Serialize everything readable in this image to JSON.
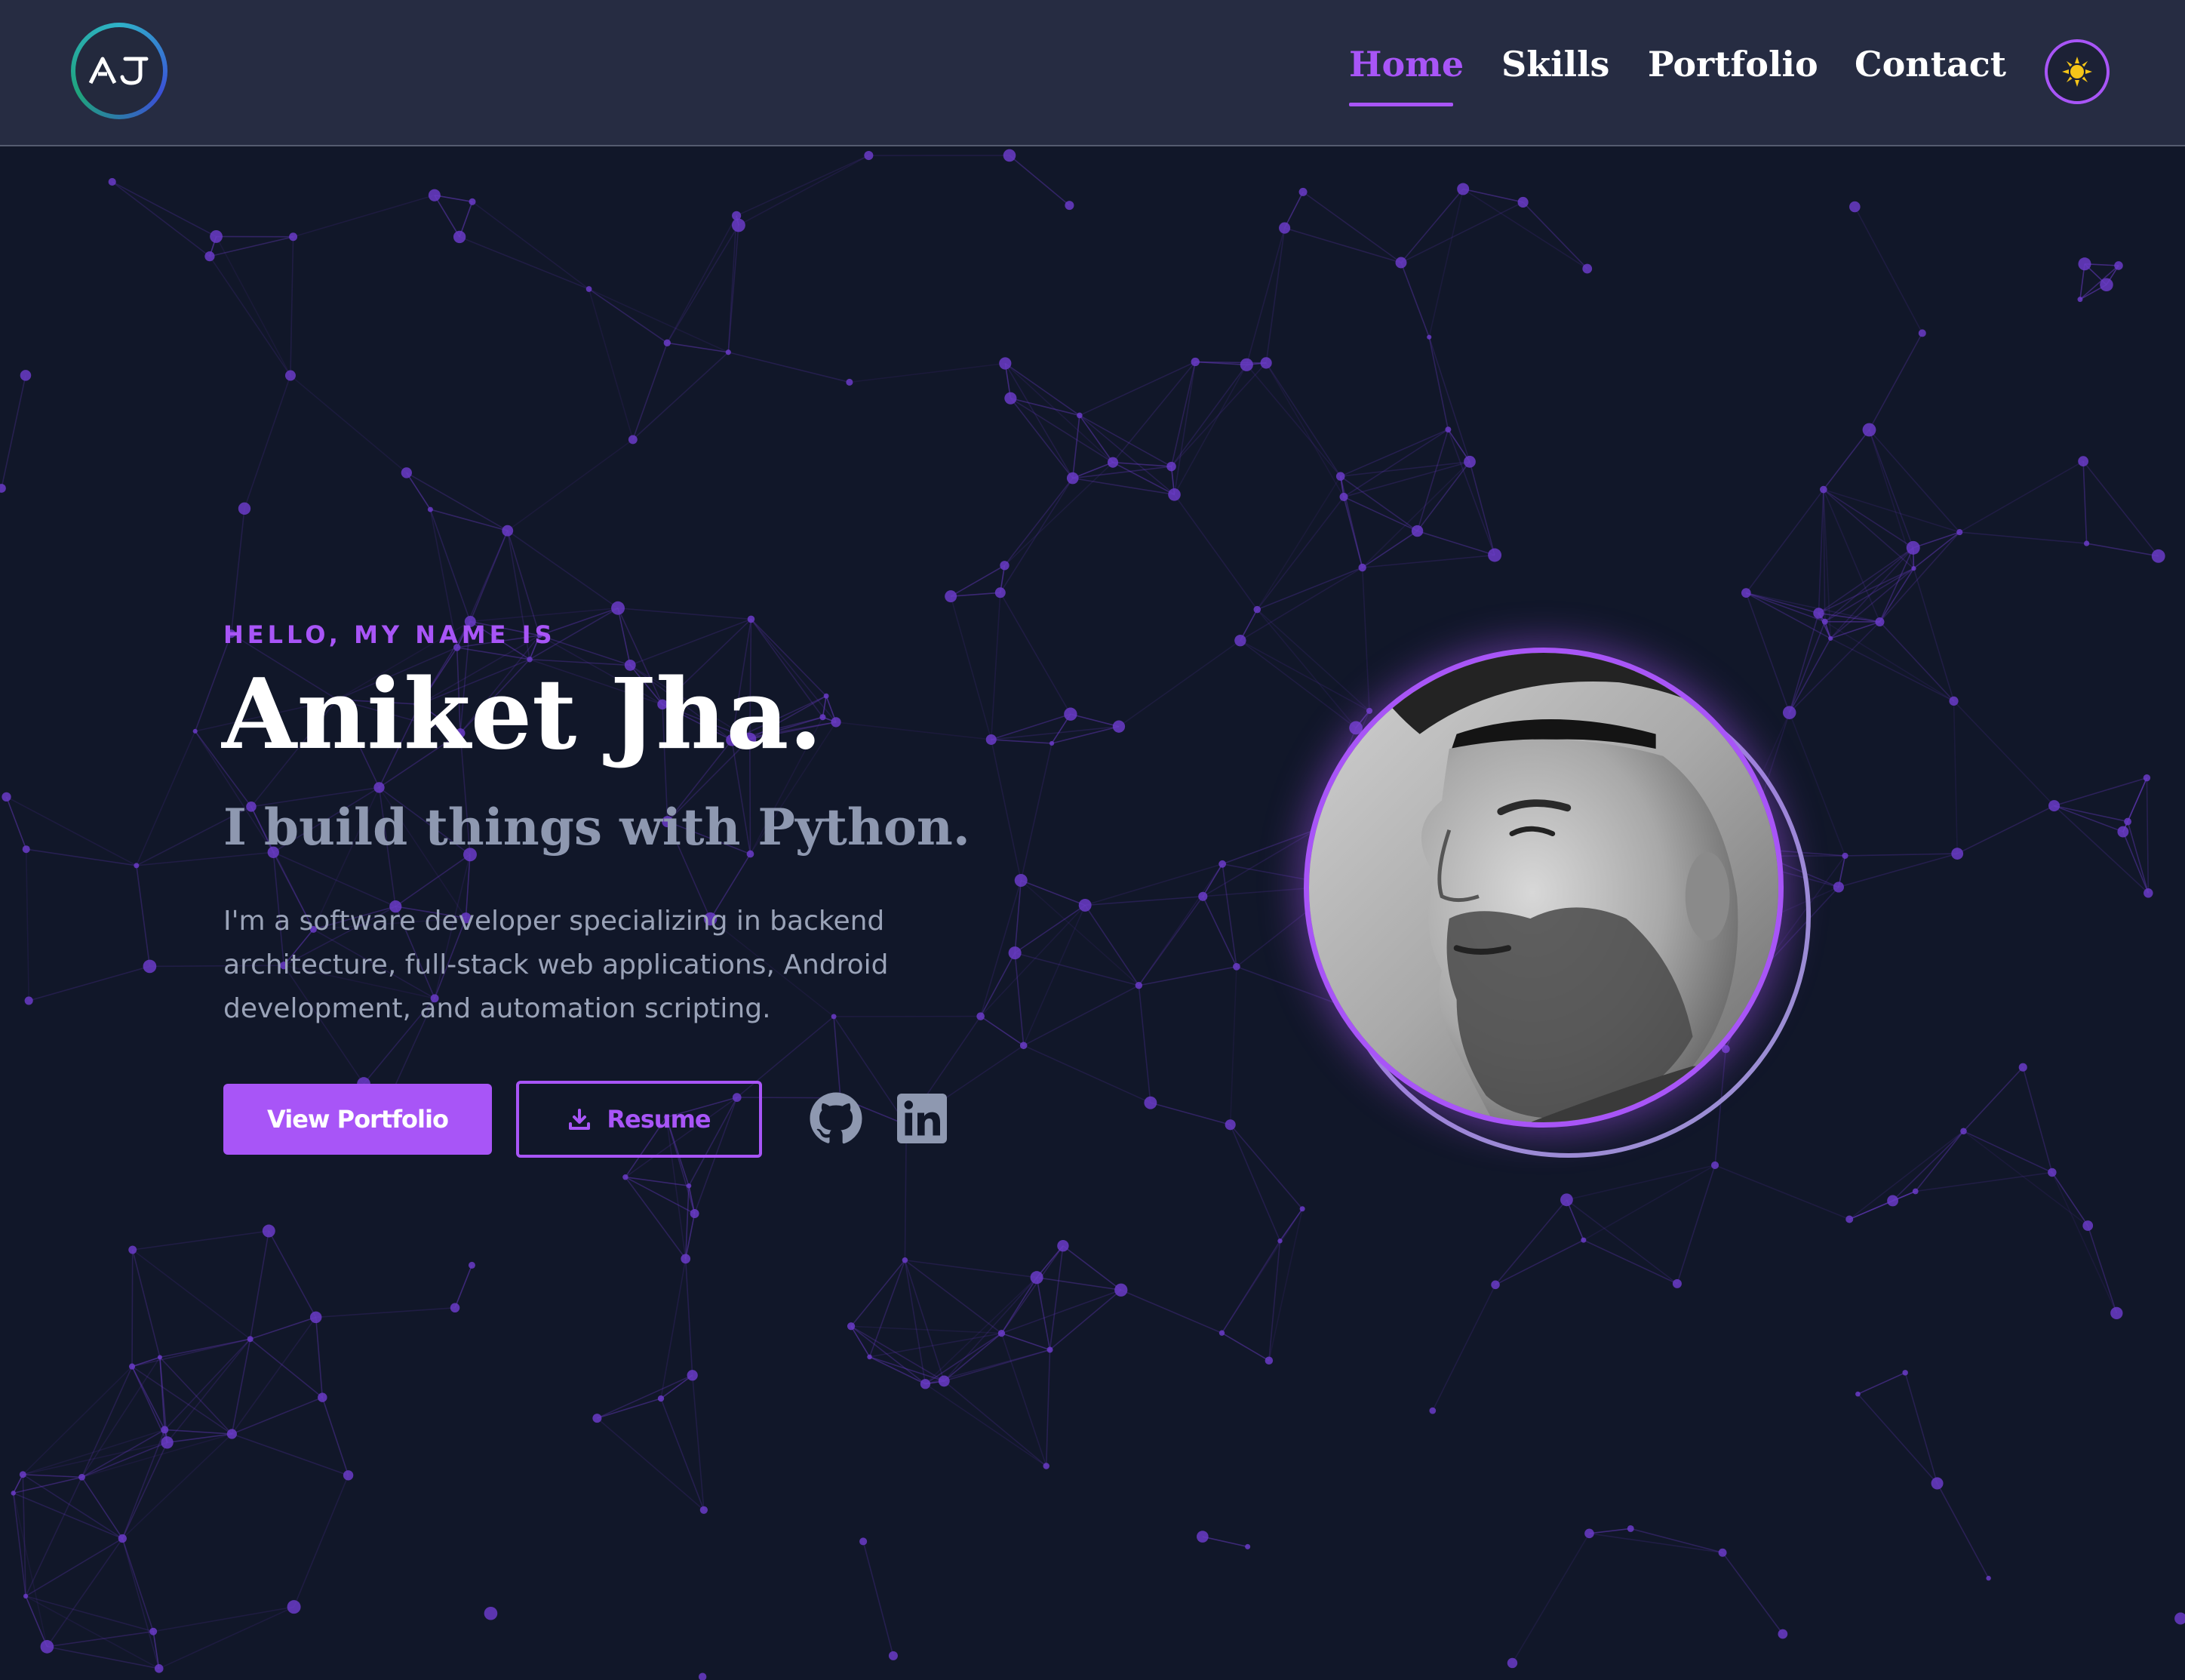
{
  "header": {
    "logo_text": "AJ",
    "nav": [
      {
        "label": "Home",
        "active": true
      },
      {
        "label": "Skills",
        "active": false
      },
      {
        "label": "Portfolio",
        "active": false
      },
      {
        "label": "Contact",
        "active": false
      }
    ],
    "theme_toggle_icon": "sun-icon"
  },
  "hero": {
    "eyebrow": "HELLO, MY NAME IS",
    "name": "Aniket Jha.",
    "tagline": "I build things with Python.",
    "description": "I'm a software developer specializing in backend architecture, full-stack web applications, Android development, and automation scripting.",
    "buttons": {
      "portfolio_label": "View Portfolio",
      "resume_label": "Resume",
      "resume_icon": "download-icon"
    },
    "social": [
      {
        "name": "GitHub",
        "icon": "github-icon"
      },
      {
        "name": "LinkedIn",
        "icon": "linkedin-icon"
      }
    ],
    "profile_photo": "profile-photo"
  },
  "colors": {
    "background": "#111729",
    "header": "#262c42",
    "accent": "#a855f7",
    "text": "#ffffff",
    "muted": "#8e98b0",
    "network_nodes": "#6a3bc7"
  }
}
